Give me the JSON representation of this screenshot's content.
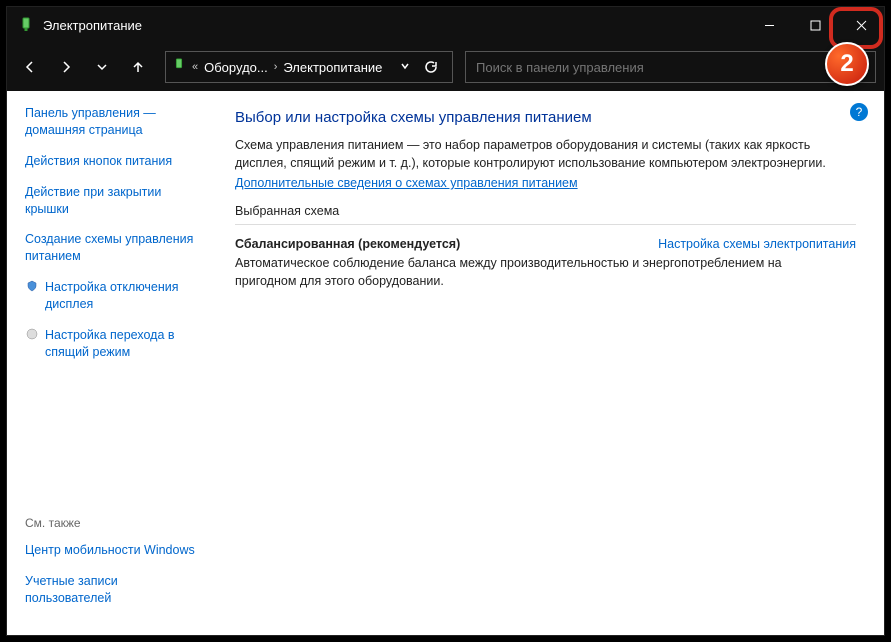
{
  "window": {
    "title": "Электропитание",
    "step_badge": "2"
  },
  "nav": {
    "crumb1": "Оборудо...",
    "crumb2": "Электропитание",
    "search_placeholder": "Поиск в панели управления"
  },
  "sidebar": {
    "home": "Панель управления — домашняя страница",
    "links": [
      "Действия кнопок питания",
      "Действие при закрытии крышки",
      "Создание схемы управления питанием",
      "Настройка отключения дисплея",
      "Настройка перехода в спящий режим"
    ],
    "see_also_label": "См. также",
    "see_also": [
      "Центр мобильности Windows",
      "Учетные записи пользователей"
    ]
  },
  "main": {
    "heading": "Выбор или настройка схемы управления питанием",
    "description": "Схема управления питанием — это набор параметров оборудования и системы (таких как яркость дисплея, спящий режим и т. д.), которые контролируют использование компьютером электроэнергии.",
    "more_info": "Дополнительные сведения о схемах управления питанием",
    "section": "Выбранная схема",
    "plan_name": "Сбалансированная (рекомендуется)",
    "plan_link": "Настройка схемы электропитания",
    "plan_desc": "Автоматическое соблюдение баланса между производительностью и энергопотреблением на пригодном для этого оборудовании."
  }
}
